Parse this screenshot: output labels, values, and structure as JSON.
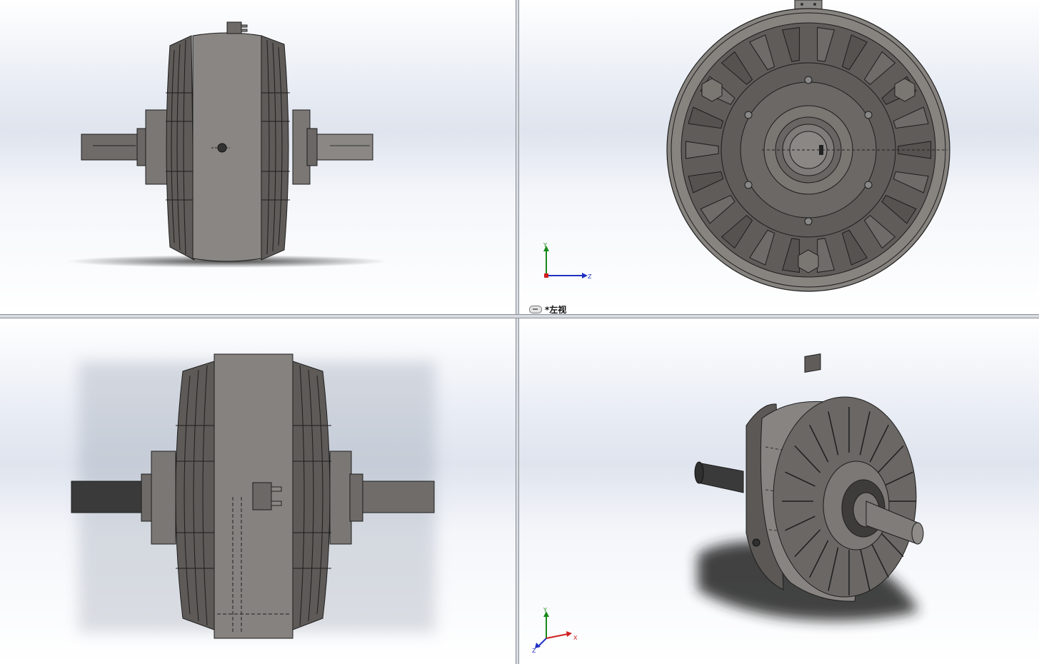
{
  "viewports": {
    "top_left": {
      "name": "front-view"
    },
    "top_right": {
      "name": "left-view",
      "label": "*左视",
      "triad": {
        "y": "Y",
        "z": "Z"
      }
    },
    "bottom_left": {
      "name": "top-view"
    },
    "bottom_right": {
      "name": "isometric-view",
      "triad": {
        "y": "Y",
        "x": "X",
        "z": "Z"
      }
    }
  },
  "colors": {
    "body": "#7b7875",
    "body_dark": "#55524f",
    "body_light": "#9a9794",
    "edge": "#1e1e1e",
    "shaft_dark": "#3a3a3a",
    "axis_x": "#d02020",
    "axis_y": "#1a8a1a",
    "axis_z": "#2030c0"
  }
}
